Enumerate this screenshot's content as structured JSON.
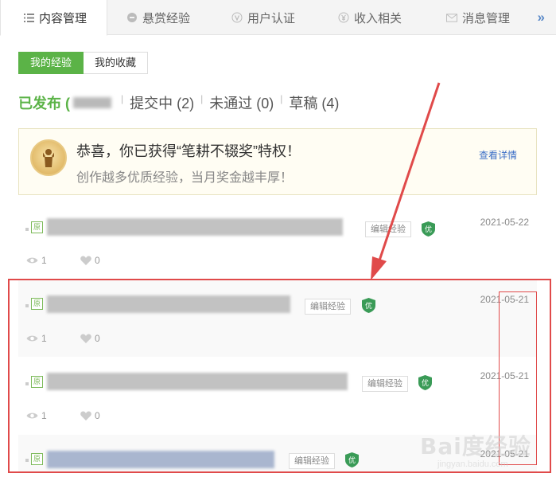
{
  "tabs": [
    {
      "label": "内容管理",
      "icon": "list-icon",
      "active": true
    },
    {
      "label": "悬赏经验",
      "icon": "coin-icon",
      "active": false
    },
    {
      "label": "用户认证",
      "icon": "v-badge-icon",
      "active": false
    },
    {
      "label": "收入相关",
      "icon": "yen-icon",
      "active": false
    },
    {
      "label": "消息管理",
      "icon": "mail-icon",
      "active": false
    }
  ],
  "tabs_more": "»",
  "subtabs": {
    "mine": "我的经验",
    "favorites": "我的收藏"
  },
  "status": {
    "published": "已发布 (",
    "submitting": "提交中 (2)",
    "rejected": "未通过 (0)",
    "draft": "草稿 (4)"
  },
  "banner": {
    "title": "恭喜，你已获得“笔耕不辍奖”特权！",
    "subtitle": "创作越多优质经验，当月奖金越丰厚！",
    "link": "查看详情"
  },
  "items": [
    {
      "tag": "原",
      "edit": "编辑经验",
      "badge": "优",
      "date": "2021-05-22",
      "views": "1",
      "likes": "0"
    },
    {
      "tag": "原",
      "edit": "编辑经验",
      "badge": "优",
      "date": "2021-05-21",
      "views": "1",
      "likes": "0"
    },
    {
      "tag": "原",
      "edit": "编辑经验",
      "badge": "优",
      "date": "2021-05-21",
      "views": "1",
      "likes": "0"
    },
    {
      "tag": "原",
      "edit": "编辑经验",
      "badge": "优",
      "date": "2021-05-21",
      "views": "",
      "likes": ""
    }
  ],
  "watermark": {
    "brand": "Bai度经验",
    "url": "jingyan.baidu.com"
  },
  "colors": {
    "accent_green": "#5bb347",
    "link_blue": "#3c6fc7",
    "annotation_red": "#e04a4a"
  }
}
